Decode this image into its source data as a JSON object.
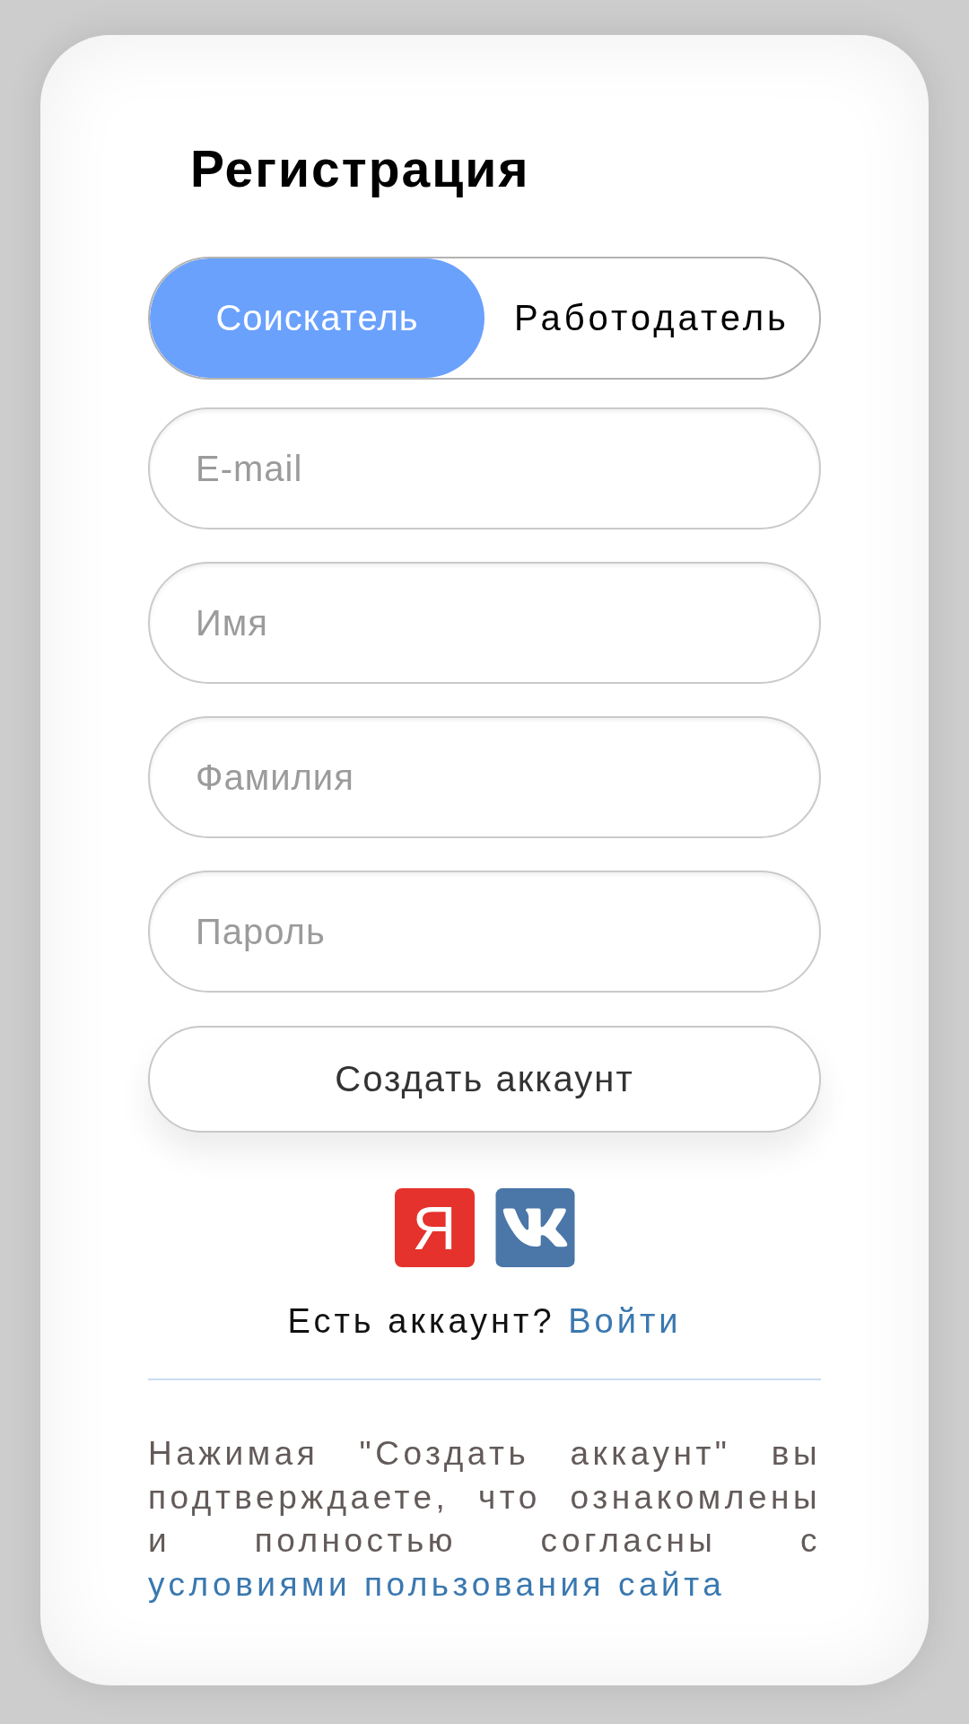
{
  "title": "Регистрация",
  "tabs": [
    {
      "label": "Соискатель",
      "selected": true
    },
    {
      "label": "Работодатель",
      "selected": false
    }
  ],
  "fields": [
    {
      "placeholder": "E-mail"
    },
    {
      "placeholder": "Имя"
    },
    {
      "placeholder": "Фамилия"
    },
    {
      "placeholder": "Пароль"
    }
  ],
  "submit_button": "Создать аккаунт",
  "social_logins": [
    {
      "kind": "letter",
      "label": "Я"
    },
    {
      "kind": "vk"
    }
  ],
  "login_prompt": {
    "text": "Есть аккаунт?",
    "link": "Войти"
  },
  "terms": {
    "text": "Нажимая \"Создать аккаунт\" вы подтверждаете, что ознакомлены и полностью согласны с",
    "link": "условиями пользования сайта"
  }
}
